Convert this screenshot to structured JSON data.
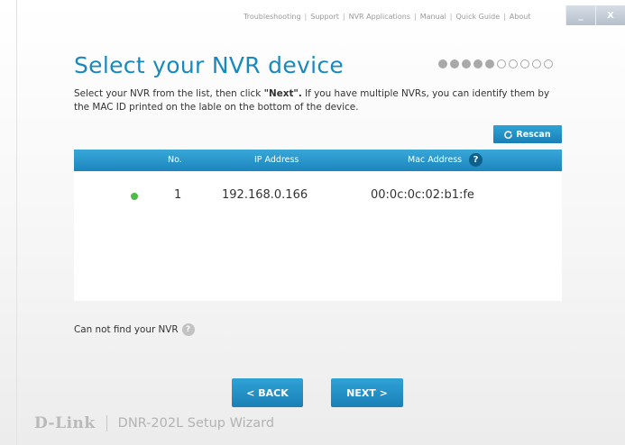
{
  "topnav": {
    "links": [
      "Troubleshooting",
      "Support",
      "NVR Applications",
      "Manual",
      "Quick Guide",
      "About"
    ]
  },
  "window_controls": {
    "minimize": "_",
    "close": "X"
  },
  "page": {
    "title": "Select your NVR device",
    "progress": {
      "total_steps": 10,
      "completed_steps": 5
    },
    "description_part1": "Select your NVR from the list, then click ",
    "description_bold": "\"Next\".",
    "description_part2": "  If you have multiple NVRs, you can identify them by the MAC ID printed on the lable on the bottom of the device."
  },
  "rescan_button": {
    "icon": "refresh-icon",
    "label": "Rescan"
  },
  "table": {
    "headers": {
      "no": "No.",
      "ip": "IP Address",
      "mac": "Mac Address",
      "help": "?"
    },
    "rows": [
      {
        "status": "online",
        "status_color": "#4cbc44",
        "no": "1",
        "ip": "192.168.0.166",
        "mac": "00:0c:0c:02:b1:fe"
      }
    ]
  },
  "help_text": {
    "label": "Can not find your NVR",
    "icon": "?"
  },
  "nav": {
    "back_label": "< BACK",
    "next_label": "NEXT >"
  },
  "brand": {
    "logo": "D-Link",
    "model": "DNR-202L",
    "product": "Setup Wizard"
  },
  "colors": {
    "accent": "#1889c0",
    "button": "#1a7fb5",
    "status_online": "#4cbc44"
  }
}
